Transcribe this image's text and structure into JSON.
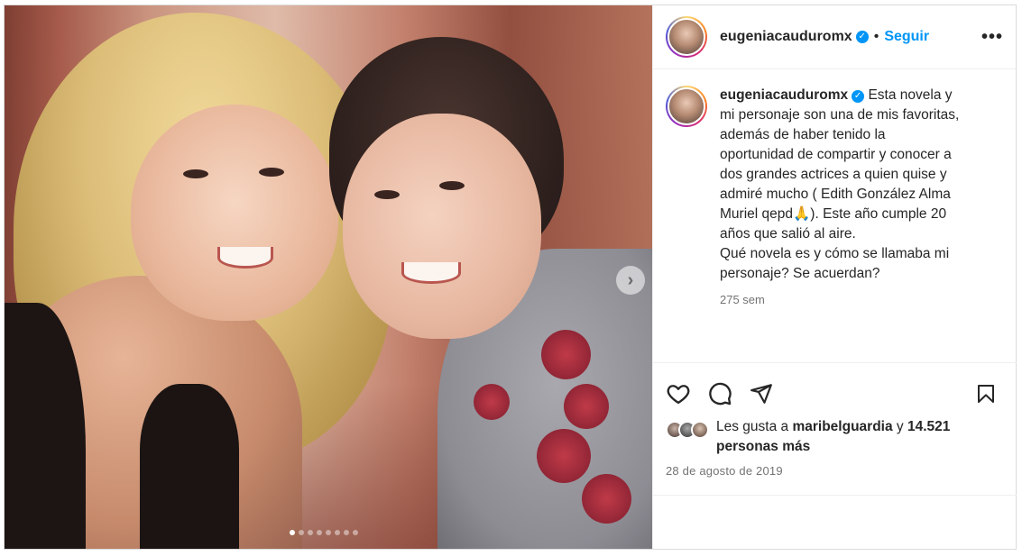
{
  "post": {
    "username": "eugeniacauduromx",
    "follow_label": "Seguir",
    "separator": "•",
    "more_label": "•••",
    "verified_mark": "✓",
    "caption_lines": [
      "Esta novela y",
      "mi personaje son una de mis favoritas,",
      "además de haber tenido la",
      "oportunidad de compartir y conocer a",
      "dos grandes actrices a quien quise y",
      "admiré mucho ( Edith González Alma",
      "Muriel qepd🙏). Este año cumple 20",
      "años que salió al aire.",
      "Qué novela es y cómo se llamaba mi",
      "personaje? Se acuerdan?"
    ],
    "caption_age": "275 sem",
    "likes_prefix": "Les gusta a",
    "likes_user": "maribelguardia",
    "likes_conj": "y",
    "likes_count": "14.521",
    "likes_suffix": "personas más",
    "date": "28 de agosto de 2019"
  },
  "media": {
    "next_label": "›",
    "slide_count": 8,
    "active_slide": 1
  },
  "icons": {
    "like": "heart-icon",
    "comment": "comment-icon",
    "share": "send-icon",
    "save": "bookmark-icon"
  },
  "colors": {
    "accent": "#0095f6",
    "text": "#262626",
    "muted": "#737373",
    "border": "#dbdbdb"
  }
}
